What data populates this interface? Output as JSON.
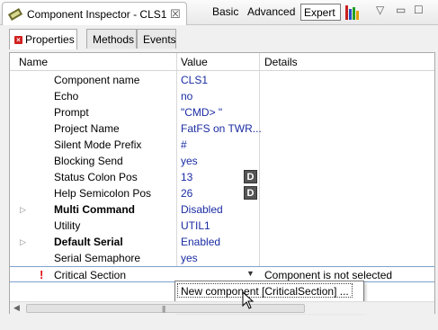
{
  "window": {
    "title": "Component Inspector - CLS1",
    "close_glyph": "☒",
    "modes": {
      "basic": "Basic",
      "advanced": "Advanced",
      "expert": "Expert"
    },
    "controls": {
      "menu": "▽",
      "minimize": "▭",
      "maximize": "☐"
    }
  },
  "tabs": [
    {
      "label": "Properties",
      "active": true
    },
    {
      "label": "Methods",
      "active": false
    },
    {
      "label": "Events",
      "active": false
    }
  ],
  "table": {
    "columns": {
      "name": "Name",
      "value": "Value",
      "details": "Details"
    },
    "rows": [
      {
        "name": "Component name",
        "value": "CLS1",
        "details": ""
      },
      {
        "name": "Echo",
        "value": "no",
        "details": ""
      },
      {
        "name": "Prompt",
        "value": "\"CMD> \"",
        "details": ""
      },
      {
        "name": "Project Name",
        "value": "FatFS on TWR...",
        "details": ""
      },
      {
        "name": "Silent Mode Prefix",
        "value": "#",
        "details": ""
      },
      {
        "name": "Blocking Send",
        "value": "yes",
        "details": ""
      },
      {
        "name": "Status Colon Pos",
        "value": "13",
        "details": "",
        "button": "D"
      },
      {
        "name": "Help Semicolon Pos",
        "value": "26",
        "details": "",
        "button": "D"
      },
      {
        "name": "Multi Command",
        "value": "Disabled",
        "details": ""
      },
      {
        "name": "Utility",
        "value": "UTIL1",
        "details": ""
      },
      {
        "name": "Default Serial",
        "value": "Enabled",
        "details": ""
      },
      {
        "name": "Serial Semaphore",
        "value": "yes",
        "details": ""
      },
      {
        "name": "Critical Section",
        "value": "",
        "details": "Component is not selected"
      }
    ]
  },
  "dropdown": {
    "item": "New component [CriticalSection] ..."
  },
  "colors": {
    "value_text": "#1a2ca3",
    "error_red": "#d21f1f"
  }
}
